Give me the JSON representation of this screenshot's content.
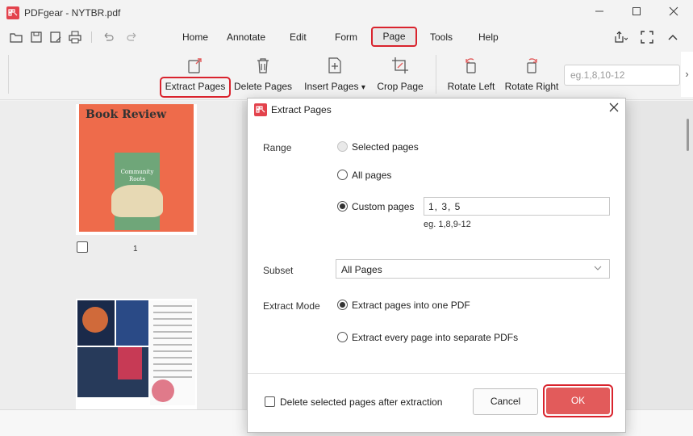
{
  "window": {
    "title": "PDFgear - NYTBR.pdf"
  },
  "menu": {
    "items": [
      "Home",
      "Annotate",
      "Edit",
      "Form",
      "Page",
      "Tools",
      "Help"
    ],
    "active": "Page"
  },
  "ribbon": {
    "tools": [
      {
        "label": "Extract Pages",
        "icon": "extract-pages-icon"
      },
      {
        "label": "Delete Pages",
        "icon": "trash-icon"
      },
      {
        "label": "Insert Pages",
        "icon": "insert-page-icon"
      },
      {
        "label": "Crop Page",
        "icon": "crop-icon"
      },
      {
        "label": "Rotate Left",
        "icon": "rotate-left-icon"
      },
      {
        "label": "Rotate Right",
        "icon": "rotate-right-icon"
      }
    ],
    "page_range_placeholder": "eg.1,8,10-12",
    "insert_dropdown": "▾"
  },
  "thumbnails": {
    "page1": {
      "title": "Book Review",
      "subtitle": "Community Roots",
      "number": "1"
    }
  },
  "dialog": {
    "title": "Extract Pages",
    "range_label": "Range",
    "opt_selected": "Selected pages",
    "opt_all": "All pages",
    "opt_custom": "Custom pages",
    "custom_value": "1,  3,  5",
    "custom_hint": "eg. 1,8,9-12",
    "subset_label": "Subset",
    "subset_value": "All Pages",
    "mode_label": "Extract Mode",
    "mode_one": "Extract pages into one PDF",
    "mode_separate": "Extract every page into separate PDFs",
    "delete_after": "Delete selected pages after extraction",
    "cancel": "Cancel",
    "ok": "OK"
  },
  "colors": {
    "accent": "#d9232d",
    "ok_button": "#e25b5b",
    "logo": "#e3424c"
  }
}
